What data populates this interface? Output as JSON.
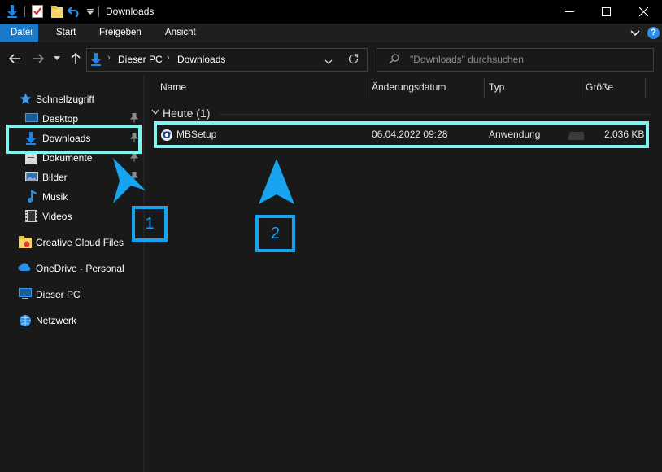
{
  "window": {
    "title": "Downloads",
    "controls": [
      "minimize-icon",
      "maximize-icon",
      "close-icon"
    ]
  },
  "ribbon": {
    "tabs": [
      {
        "label": "Datei",
        "active": true
      },
      {
        "label": "Start"
      },
      {
        "label": "Freigeben"
      },
      {
        "label": "Ansicht"
      }
    ]
  },
  "address": {
    "path": [
      "Dieser PC",
      "Downloads"
    ],
    "search_placeholder": "\"Downloads\" durchsuchen"
  },
  "nav": {
    "quick_access": "Schnellzugriff",
    "quick_items": [
      {
        "label": "Desktop",
        "icon": "desktop-folder-icon",
        "pinned": true
      },
      {
        "label": "Downloads",
        "icon": "download-arrow-icon",
        "pinned": true
      },
      {
        "label": "Dokumente",
        "icon": "documents-folder-icon",
        "pinned": true
      },
      {
        "label": "Bilder",
        "icon": "pictures-folder-icon",
        "pinned": true
      },
      {
        "label": "Musik",
        "icon": "music-note-icon"
      },
      {
        "label": "Videos",
        "icon": "video-film-icon"
      }
    ],
    "other_items": [
      {
        "label": "Creative Cloud Files",
        "icon": "creative-cloud-folder-icon"
      },
      {
        "label": "OneDrive - Personal",
        "icon": "cloud-icon"
      },
      {
        "label": "Dieser PC",
        "icon": "computer-icon"
      },
      {
        "label": "Netzwerk",
        "icon": "network-icon"
      }
    ]
  },
  "columns": {
    "name": "Name",
    "date": "Änderungsdatum",
    "type": "Typ",
    "size": "Größe"
  },
  "group": {
    "label": "Heute (1)"
  },
  "files": [
    {
      "name": "MBSetup",
      "date": "06.04.2022 09:28",
      "type": "Anwendung",
      "size": "2.036 KB"
    }
  ],
  "annotations": {
    "one": "1",
    "two": "2"
  },
  "colors": {
    "accent": "#1979ca",
    "highlight": "#7ff5f1",
    "marker": "#17a3ef"
  }
}
